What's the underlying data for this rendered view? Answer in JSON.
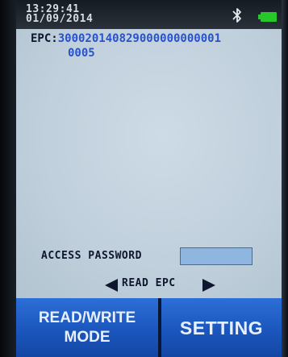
{
  "status": {
    "time": "13:29:41",
    "date": "01/09/2014",
    "icons": [
      "bluetooth-icon",
      "battery-icon"
    ],
    "battery_color": "#27c82a"
  },
  "epc": {
    "label": "EPC:",
    "value_line1": "300020140829000000000001",
    "value_line2": "0005",
    "value_color": "#2a52c8"
  },
  "access_password": {
    "label": "ACCESS PASSWORD",
    "value": ""
  },
  "nav": {
    "label": "READ EPC",
    "left_icon": "arrow-left-icon",
    "right_icon": "arrow-right-icon"
  },
  "buttons": {
    "read_write_line1": "READ/WRITE",
    "read_write_line2": "MODE",
    "setting": "SETTING",
    "accent": "#1b56bd"
  }
}
